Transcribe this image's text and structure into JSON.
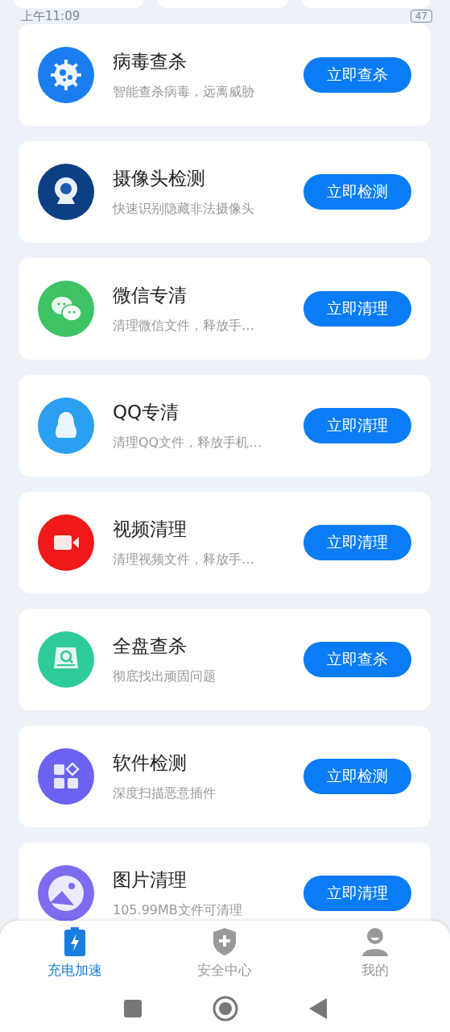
{
  "status_bar": {
    "time": "上午11:09",
    "battery": "47"
  },
  "tools": [
    {
      "kind": "virus",
      "title": "病毒查杀",
      "subtitle": "智能查杀病毒，远离威胁",
      "action": "立即查杀"
    },
    {
      "kind": "camera",
      "title": "摄像头检测",
      "subtitle": "快速识别隐藏非法摄像头",
      "action": "立即检测"
    },
    {
      "kind": "chat",
      "title": "微信专清",
      "subtitle": "清理微信文件，释放手…",
      "action": "立即清理"
    },
    {
      "kind": "penguin",
      "title": "QQ专清",
      "subtitle": "清理QQ文件，释放手机…",
      "action": "立即清理"
    },
    {
      "kind": "video",
      "title": "视频清理",
      "subtitle": "清理视频文件，释放手…",
      "action": "立即清理"
    },
    {
      "kind": "disk",
      "title": "全盘查杀",
      "subtitle": "彻底找出顽固问题",
      "action": "立即查杀"
    },
    {
      "kind": "apps",
      "title": "软件检测",
      "subtitle": "深度扫描恶意插件",
      "action": "立即检测"
    },
    {
      "kind": "photo",
      "title": "图片清理",
      "subtitle": "105.99MB文件可清理",
      "action": "立即清理"
    }
  ],
  "tabs": [
    {
      "kind": "battery",
      "label": "充电加速",
      "selected": true
    },
    {
      "kind": "shield",
      "label": "安全中心",
      "selected": false
    },
    {
      "kind": "person",
      "label": "我的",
      "selected": false
    }
  ]
}
